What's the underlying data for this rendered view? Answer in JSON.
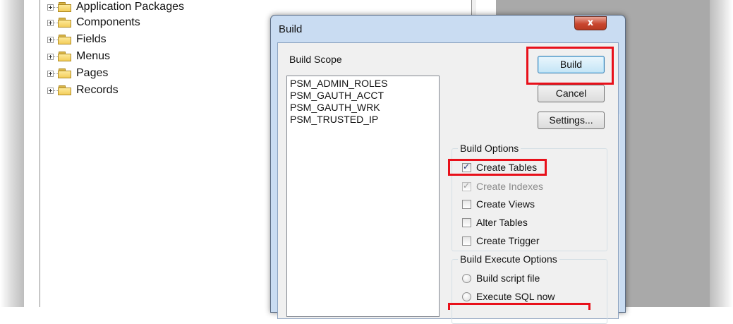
{
  "tree": {
    "items": [
      {
        "label": "Application Packages"
      },
      {
        "label": "Components"
      },
      {
        "label": "Fields"
      },
      {
        "label": "Menus"
      },
      {
        "label": "Pages"
      },
      {
        "label": "Records"
      }
    ]
  },
  "dialog": {
    "title": "Build",
    "close_label": "x",
    "build_scope_label": "Build Scope",
    "scope_items": [
      "PSM_ADMIN_ROLES",
      "PSM_GAUTH_ACCT",
      "PSM_GAUTH_WRK",
      "PSM_TRUSTED_IP"
    ],
    "buttons": {
      "build": "Build",
      "cancel": "Cancel",
      "settings": "Settings..."
    },
    "build_options": {
      "label": "Build Options",
      "items": [
        {
          "label": "Create Tables",
          "checked": true,
          "enabled": true
        },
        {
          "label": "Create Indexes",
          "checked": true,
          "enabled": false
        },
        {
          "label": "Create Views",
          "checked": false,
          "enabled": true
        },
        {
          "label": "Alter Tables",
          "checked": false,
          "enabled": true
        },
        {
          "label": "Create Trigger",
          "checked": false,
          "enabled": true
        }
      ]
    },
    "build_execute_options": {
      "label": "Build Execute Options",
      "items": [
        {
          "label": "Build script file",
          "selected": false
        },
        {
          "label": "Execute SQL now",
          "selected": false
        }
      ]
    }
  },
  "colors": {
    "highlight": "#e8101a",
    "folder": "#f3cd5a",
    "dialog_frame": "#c9dcf2"
  }
}
